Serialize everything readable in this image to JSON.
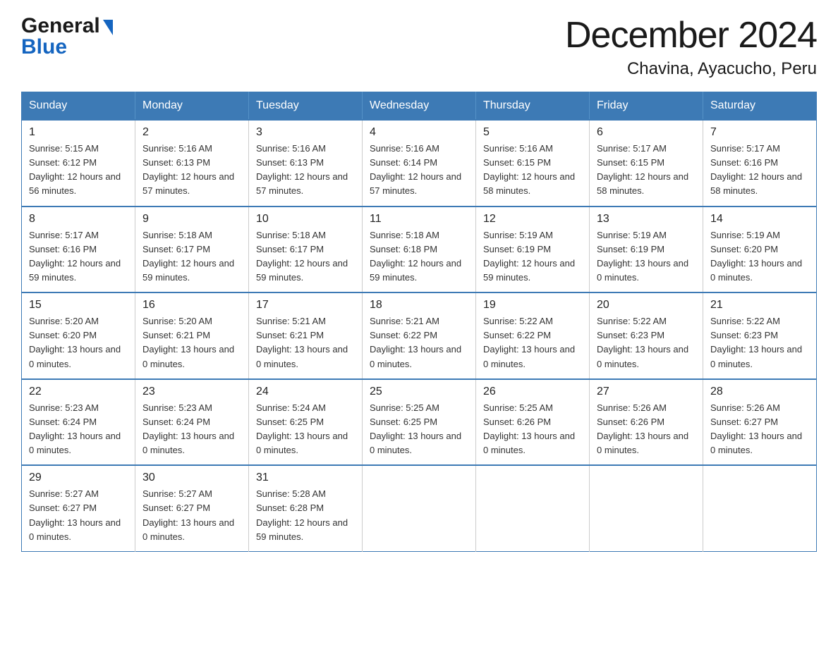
{
  "logo": {
    "general": "General",
    "blue": "Blue"
  },
  "title": "December 2024",
  "subtitle": "Chavina, Ayacucho, Peru",
  "header_days": [
    "Sunday",
    "Monday",
    "Tuesday",
    "Wednesday",
    "Thursday",
    "Friday",
    "Saturday"
  ],
  "weeks": [
    [
      {
        "day": "1",
        "sunrise": "5:15 AM",
        "sunset": "6:12 PM",
        "daylight": "12 hours and 56 minutes."
      },
      {
        "day": "2",
        "sunrise": "5:16 AM",
        "sunset": "6:13 PM",
        "daylight": "12 hours and 57 minutes."
      },
      {
        "day": "3",
        "sunrise": "5:16 AM",
        "sunset": "6:13 PM",
        "daylight": "12 hours and 57 minutes."
      },
      {
        "day": "4",
        "sunrise": "5:16 AM",
        "sunset": "6:14 PM",
        "daylight": "12 hours and 57 minutes."
      },
      {
        "day": "5",
        "sunrise": "5:16 AM",
        "sunset": "6:15 PM",
        "daylight": "12 hours and 58 minutes."
      },
      {
        "day": "6",
        "sunrise": "5:17 AM",
        "sunset": "6:15 PM",
        "daylight": "12 hours and 58 minutes."
      },
      {
        "day": "7",
        "sunrise": "5:17 AM",
        "sunset": "6:16 PM",
        "daylight": "12 hours and 58 minutes."
      }
    ],
    [
      {
        "day": "8",
        "sunrise": "5:17 AM",
        "sunset": "6:16 PM",
        "daylight": "12 hours and 59 minutes."
      },
      {
        "day": "9",
        "sunrise": "5:18 AM",
        "sunset": "6:17 PM",
        "daylight": "12 hours and 59 minutes."
      },
      {
        "day": "10",
        "sunrise": "5:18 AM",
        "sunset": "6:17 PM",
        "daylight": "12 hours and 59 minutes."
      },
      {
        "day": "11",
        "sunrise": "5:18 AM",
        "sunset": "6:18 PM",
        "daylight": "12 hours and 59 minutes."
      },
      {
        "day": "12",
        "sunrise": "5:19 AM",
        "sunset": "6:19 PM",
        "daylight": "12 hours and 59 minutes."
      },
      {
        "day": "13",
        "sunrise": "5:19 AM",
        "sunset": "6:19 PM",
        "daylight": "13 hours and 0 minutes."
      },
      {
        "day": "14",
        "sunrise": "5:19 AM",
        "sunset": "6:20 PM",
        "daylight": "13 hours and 0 minutes."
      }
    ],
    [
      {
        "day": "15",
        "sunrise": "5:20 AM",
        "sunset": "6:20 PM",
        "daylight": "13 hours and 0 minutes."
      },
      {
        "day": "16",
        "sunrise": "5:20 AM",
        "sunset": "6:21 PM",
        "daylight": "13 hours and 0 minutes."
      },
      {
        "day": "17",
        "sunrise": "5:21 AM",
        "sunset": "6:21 PM",
        "daylight": "13 hours and 0 minutes."
      },
      {
        "day": "18",
        "sunrise": "5:21 AM",
        "sunset": "6:22 PM",
        "daylight": "13 hours and 0 minutes."
      },
      {
        "day": "19",
        "sunrise": "5:22 AM",
        "sunset": "6:22 PM",
        "daylight": "13 hours and 0 minutes."
      },
      {
        "day": "20",
        "sunrise": "5:22 AM",
        "sunset": "6:23 PM",
        "daylight": "13 hours and 0 minutes."
      },
      {
        "day": "21",
        "sunrise": "5:22 AM",
        "sunset": "6:23 PM",
        "daylight": "13 hours and 0 minutes."
      }
    ],
    [
      {
        "day": "22",
        "sunrise": "5:23 AM",
        "sunset": "6:24 PM",
        "daylight": "13 hours and 0 minutes."
      },
      {
        "day": "23",
        "sunrise": "5:23 AM",
        "sunset": "6:24 PM",
        "daylight": "13 hours and 0 minutes."
      },
      {
        "day": "24",
        "sunrise": "5:24 AM",
        "sunset": "6:25 PM",
        "daylight": "13 hours and 0 minutes."
      },
      {
        "day": "25",
        "sunrise": "5:25 AM",
        "sunset": "6:25 PM",
        "daylight": "13 hours and 0 minutes."
      },
      {
        "day": "26",
        "sunrise": "5:25 AM",
        "sunset": "6:26 PM",
        "daylight": "13 hours and 0 minutes."
      },
      {
        "day": "27",
        "sunrise": "5:26 AM",
        "sunset": "6:26 PM",
        "daylight": "13 hours and 0 minutes."
      },
      {
        "day": "28",
        "sunrise": "5:26 AM",
        "sunset": "6:27 PM",
        "daylight": "13 hours and 0 minutes."
      }
    ],
    [
      {
        "day": "29",
        "sunrise": "5:27 AM",
        "sunset": "6:27 PM",
        "daylight": "13 hours and 0 minutes."
      },
      {
        "day": "30",
        "sunrise": "5:27 AM",
        "sunset": "6:27 PM",
        "daylight": "13 hours and 0 minutes."
      },
      {
        "day": "31",
        "sunrise": "5:28 AM",
        "sunset": "6:28 PM",
        "daylight": "12 hours and 59 minutes."
      },
      null,
      null,
      null,
      null
    ]
  ]
}
